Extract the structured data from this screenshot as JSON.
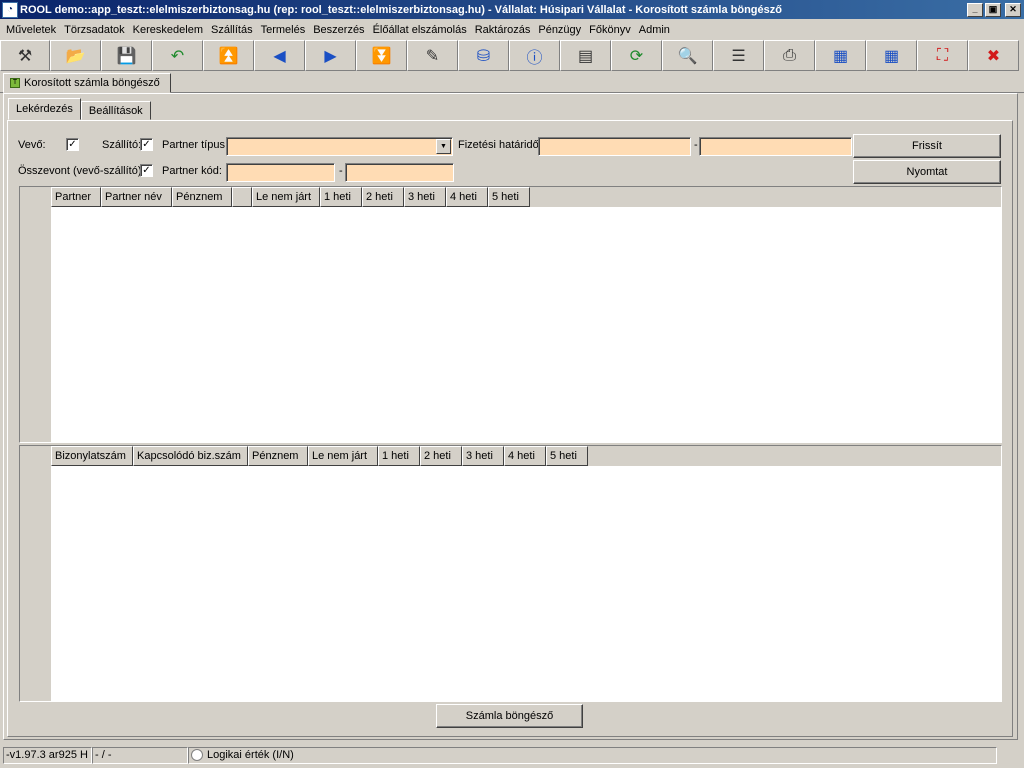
{
  "window": {
    "title": "ROOL demo::app_teszt::elelmiszerbiztonsag.hu (rep: rool_teszt::elelmiszerbiztonsag.hu) - Vállalat: Húsipari Vállalat - Korosított számla böngésző",
    "controls": {
      "minimize": "_",
      "maximize": "▣",
      "close": "✕"
    }
  },
  "menu": [
    "Műveletek",
    "Törzsadatok",
    "Kereskedelem",
    "Szállítás",
    "Termelés",
    "Beszerzés",
    "Élőállat elszámolás",
    "Raktározás",
    "Pénzügy",
    "Főkönyv",
    "Admin"
  ],
  "toolbar": {
    "icons": [
      {
        "name": "tools-icon",
        "glyph": "⚒",
        "cls": "ic-dark"
      },
      {
        "name": "open-folder-icon",
        "glyph": "📂",
        "cls": "ic-blue"
      },
      {
        "name": "save-icon",
        "glyph": "💾",
        "cls": "ic-blue"
      },
      {
        "name": "undo-icon",
        "glyph": "↶",
        "cls": "ic-green"
      },
      {
        "name": "first-record-icon",
        "glyph": "⏫",
        "cls": "ic-blue"
      },
      {
        "name": "previous-icon",
        "glyph": "◀",
        "cls": "ic-blue"
      },
      {
        "name": "next-icon",
        "glyph": "▶",
        "cls": "ic-blue"
      },
      {
        "name": "last-record-icon",
        "glyph": "⏬",
        "cls": "ic-blue"
      },
      {
        "name": "edit-icon",
        "glyph": "✎",
        "cls": "ic-dark"
      },
      {
        "name": "database-icon",
        "glyph": "⛁",
        "cls": "ic-blue"
      },
      {
        "name": "info-icon",
        "glyph": "ⓘ",
        "cls": "ic-blue"
      },
      {
        "name": "window-layout-icon",
        "glyph": "▤",
        "cls": "ic-dark"
      },
      {
        "name": "refresh-icon",
        "glyph": "⟳",
        "cls": "ic-green"
      },
      {
        "name": "search-icon",
        "glyph": "🔍",
        "cls": "ic-dark"
      },
      {
        "name": "row-height-icon",
        "glyph": "☰",
        "cls": "ic-dark"
      },
      {
        "name": "print-icon",
        "glyph": "⎙",
        "cls": "ic-dark"
      },
      {
        "name": "table-export-icon",
        "glyph": "▦",
        "cls": "ic-blue"
      },
      {
        "name": "table-import-icon",
        "glyph": "▦",
        "cls": "ic-blue"
      },
      {
        "name": "maximize-frame-icon",
        "glyph": "⛶",
        "cls": "ic-red"
      },
      {
        "name": "close-icon",
        "glyph": "✖",
        "cls": "ic-red"
      }
    ]
  },
  "doc_tab": {
    "label": "Korosított számla böngésző",
    "icon_glyph": "T"
  },
  "sub_tabs": {
    "query": "Lekérdezés",
    "settings": "Beállítások"
  },
  "filters": {
    "buyer_label": "Vevő:",
    "buyer_checked": "✓",
    "supplier_label": "Szállító:",
    "supplier_checked": "✓",
    "merged_label": "Összevont (vevő-szállító):",
    "merged_checked": "✓",
    "partner_type_label": "Partner típus:",
    "partner_type_value": "",
    "combo_arrow": "▼",
    "due_date_label": "Fizetési határidő:",
    "due_from": "",
    "range_sep": "-",
    "due_to": "",
    "partner_code_label": "Partner kód:",
    "partner_code_from": "",
    "partner_code_to": ""
  },
  "buttons": {
    "refresh": "Frissít",
    "print": "Nyomtat",
    "invoice_browser": "Számla böngésző"
  },
  "grid_top": {
    "headers": [
      "Partner",
      "Partner név",
      "Pénznem",
      "",
      "Le nem járt",
      "1 heti",
      "2 heti",
      "3 heti",
      "4 heti",
      "5 heti"
    ]
  },
  "grid_bottom": {
    "headers": [
      "Bizonylatszám",
      "Kapcsolódó biz.szám",
      "Pénznem",
      "Le nem járt",
      "1 heti",
      "2 heti",
      "3 heti",
      "4 heti",
      "5 heti"
    ]
  },
  "status": {
    "version": "-v1.97.3 ar925 H",
    "position": "- / -",
    "empty": "",
    "hint": "Logikai érték (I/N)"
  }
}
